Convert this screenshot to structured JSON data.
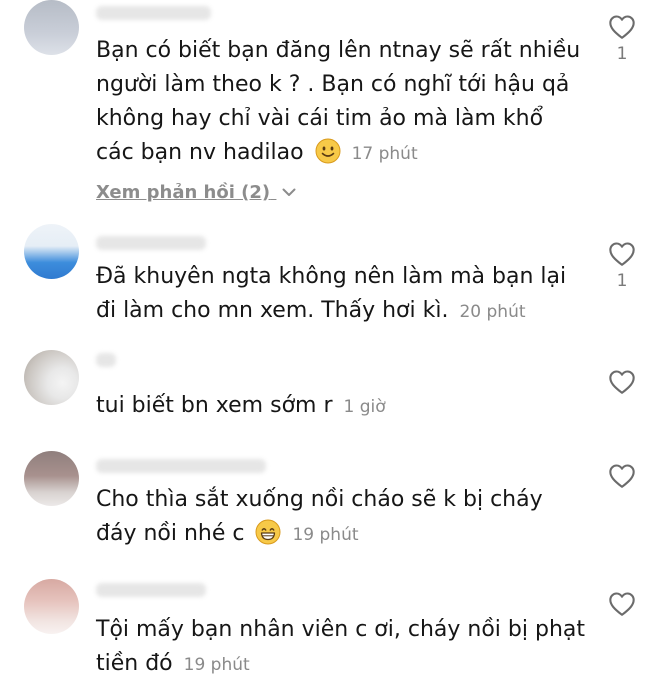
{
  "comments": [
    {
      "text": "Bạn có biết bạn đăng lên ntnay sẽ rất nhiều người làm theo k ? . Bạn có nghĩ tới hậu qả không hay chỉ vài cái tim ảo mà làm khổ các bạn nv hadilao",
      "emoji": "slightly-smiling-face-icon",
      "time": "17 phút",
      "likes": "1",
      "replies_label": "Xem phản hồi (2)"
    },
    {
      "text": "Đã khuyên ngta không nên làm mà bạn lại đi làm cho mn xem. Thấy hơi kì.",
      "time": "20 phút",
      "likes": "1"
    },
    {
      "text": "tui biết bn xem sớm r",
      "time": "1 giờ"
    },
    {
      "text": "Cho thìa sắt xuống nồi cháo sẽ k bị cháy đáy nồi nhé c",
      "emoji": "grinning-face-icon",
      "time": "19 phút"
    },
    {
      "text": "Tội mấy bạn nhân viên c ơi, cháy nồi bị phạt tiền đó",
      "time": "19 phút"
    }
  ],
  "colors": {
    "text": "#161616",
    "meta": "#8a8a8a",
    "heart_stroke": "#6b6b6b"
  }
}
